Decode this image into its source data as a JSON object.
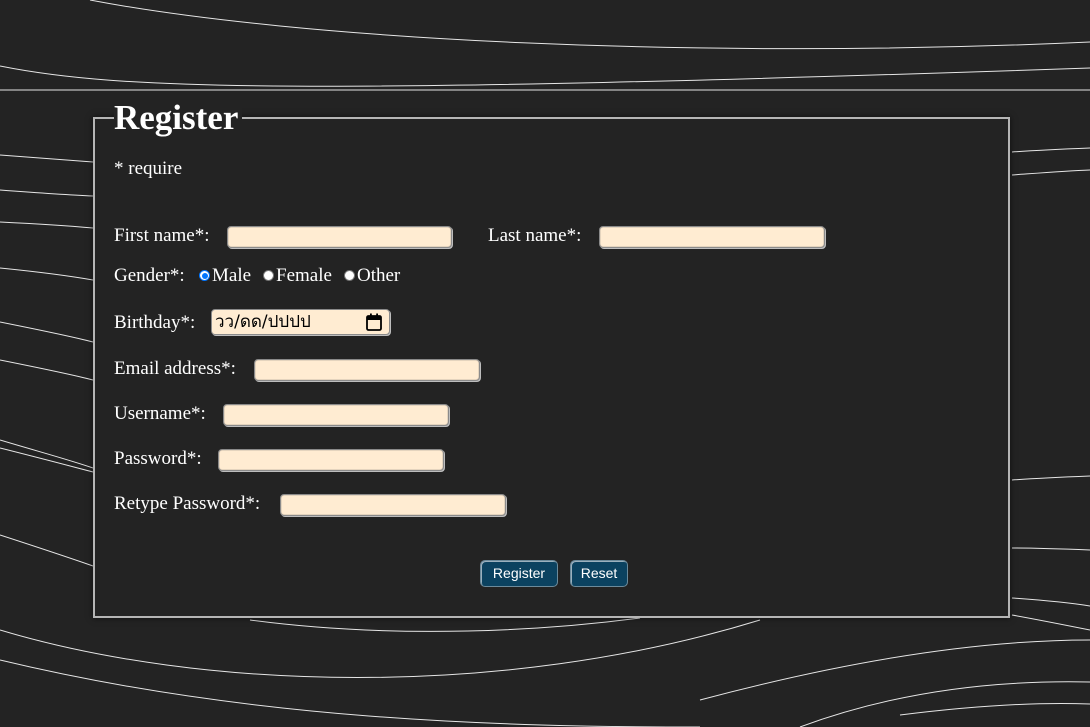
{
  "form": {
    "title": "Register",
    "require_note": "* require",
    "first_name_label": "First name*:",
    "last_name_label": "Last name*:",
    "gender_label": "Gender*:",
    "gender_options": [
      {
        "label": "Male",
        "checked": true
      },
      {
        "label": "Female",
        "checked": false
      },
      {
        "label": "Other",
        "checked": false
      }
    ],
    "birthday_label": "Birthday*:",
    "birthday_placeholder": "วว/ดด/ปปปป",
    "email_label": "Email address*:",
    "username_label": "Username*:",
    "password_label": "Password*:",
    "retype_password_label": "Retype Password*:",
    "register_button": "Register",
    "reset_button": "Reset"
  },
  "colors": {
    "background": "#232323",
    "field_fill": "#ffecd2",
    "button_fill": "#0b4260",
    "radio_accent": "#0075ff"
  },
  "icons": [
    "calendar-icon"
  ]
}
